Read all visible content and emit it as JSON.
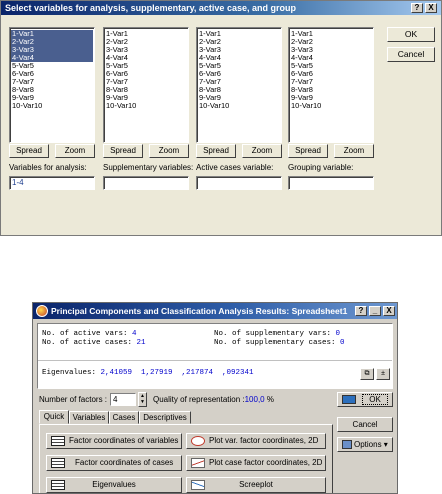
{
  "dialog1": {
    "title": "Select variables for analysis, supplementary, active case, and group",
    "title_buttons": [
      "?",
      "X"
    ],
    "lists": [
      {
        "name": "analysis",
        "items": [
          "1-Var1",
          "2-Var2",
          "3-Var3",
          "4-Var4",
          "5-Var5",
          "6-Var6",
          "7-Var7",
          "8-Var8",
          "9-Var9",
          "10-Var10"
        ],
        "selected": [
          0,
          1,
          2,
          3
        ],
        "spread": "Spread",
        "zoom": "Zoom",
        "field_label": "Variables for analysis:",
        "field_value": "1-4"
      },
      {
        "name": "supplementary",
        "items": [
          "1-Var1",
          "2-Var2",
          "3-Var3",
          "4-Var4",
          "5-Var5",
          "6-Var6",
          "7-Var7",
          "8-Var8",
          "9-Var9",
          "10-Var10"
        ],
        "selected": [],
        "spread": "Spread",
        "zoom": "Zoom",
        "field_label": "Supplementary variables:",
        "field_value": ""
      },
      {
        "name": "active-cases",
        "items": [
          "1-Var1",
          "2-Var2",
          "3-Var3",
          "4-Var4",
          "5-Var5",
          "6-Var6",
          "7-Var7",
          "8-Var8",
          "9-Var9",
          "10-Var10"
        ],
        "selected": [],
        "spread": "Spread",
        "zoom": "Zoom",
        "field_label": "Active cases variable:",
        "field_value": ""
      },
      {
        "name": "grouping",
        "items": [
          "1-Var1",
          "2-Var2",
          "3-Var3",
          "4-Var4",
          "5-Var5",
          "6-Var6",
          "7-Var7",
          "8-Var8",
          "9-Var9",
          "10-Var10"
        ],
        "selected": [],
        "spread": "Spread",
        "zoom": "Zoom",
        "field_label": "Grouping variable:",
        "field_value": ""
      }
    ],
    "ok": "OK",
    "cancel": "Cancel"
  },
  "dialog2": {
    "title": "Principal Components and Classification Analysis Results: Spreadsheet1",
    "title_buttons": [
      "?",
      "_",
      "X"
    ],
    "info": {
      "active_vars_label": "No. of active vars:",
      "active_vars": "4",
      "active_cases_label": "No. of active cases:",
      "active_cases": "21",
      "supp_vars_label": "No. of supplementary vars:",
      "supp_vars": "0",
      "supp_cases_label": "No. of supplementary cases:",
      "supp_cases": "0",
      "eigen_label": "Eigenvalues:",
      "eigenvalues": "2,41059  1,27919  ,217874  ,092341"
    },
    "factors_label": "Number of factors :",
    "factors_value": "4",
    "quality_label": "Quality of representation :",
    "quality_value": "100,0",
    "quality_unit": "%",
    "tabs": [
      "Quick",
      "Variables",
      "Cases",
      "Descriptives"
    ],
    "buttons": {
      "factor_vars": "Factor coordinates of variables",
      "plot_var": "Plot var. factor coordinates, 2D",
      "factor_cases": "Factor coordinates of cases",
      "plot_case": "Plot case factor coordinates, 2D",
      "eigenvalues": "Eigenvalues",
      "screeplot": "Screeplot"
    },
    "ok": "OK",
    "cancel": "Cancel",
    "options": "Options"
  }
}
